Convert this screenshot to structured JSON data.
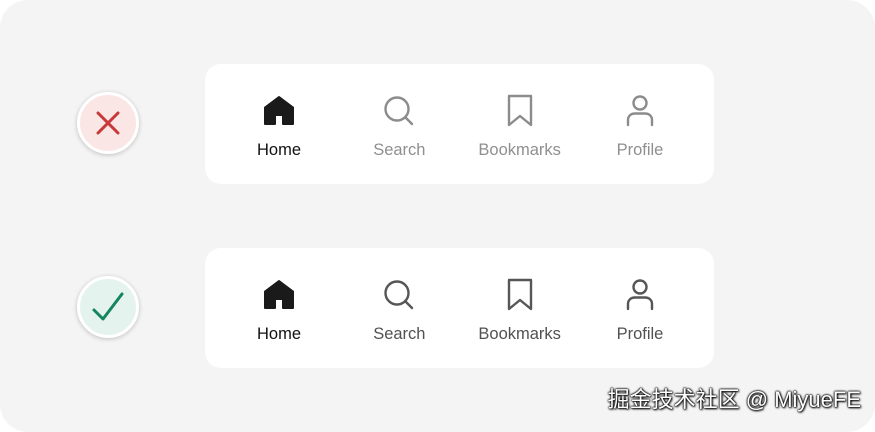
{
  "examples": [
    {
      "verdict": "incorrect",
      "verdict_icon": "cross-icon",
      "verdict_color": "#c83a3a",
      "inactive_color": "#8c8c8c",
      "active_index": 0,
      "nav_items": [
        {
          "label": "Home",
          "icon": "home-icon"
        },
        {
          "label": "Search",
          "icon": "search-icon"
        },
        {
          "label": "Bookmarks",
          "icon": "bookmark-icon"
        },
        {
          "label": "Profile",
          "icon": "profile-icon"
        }
      ]
    },
    {
      "verdict": "correct",
      "verdict_icon": "check-icon",
      "verdict_color": "#13855f",
      "inactive_color": "#565656",
      "active_index": 0,
      "nav_items": [
        {
          "label": "Home",
          "icon": "home-icon"
        },
        {
          "label": "Search",
          "icon": "search-icon"
        },
        {
          "label": "Bookmarks",
          "icon": "bookmark-icon"
        },
        {
          "label": "Profile",
          "icon": "profile-icon"
        }
      ]
    }
  ],
  "watermark": "掘金技术社区 @ MiyueFE"
}
